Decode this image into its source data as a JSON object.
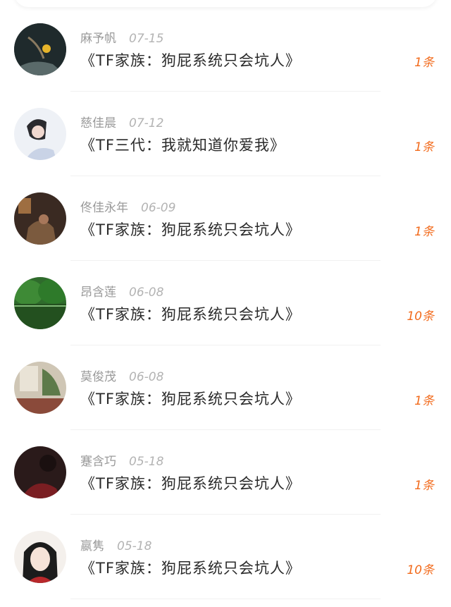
{
  "messages": [
    {
      "name": "麻予帆",
      "date": "07-15",
      "title": "《TF家族：狗屁系统只会坑人》",
      "count": "1条",
      "avatar": "avatar-1"
    },
    {
      "name": "慈佳晨",
      "date": "07-12",
      "title": "《TF三代：我就知道你爱我》",
      "count": "1条",
      "avatar": "avatar-2"
    },
    {
      "name": "佟佳永年",
      "date": "06-09",
      "title": "《TF家族：狗屁系统只会坑人》",
      "count": "1条",
      "avatar": "avatar-3"
    },
    {
      "name": "昂含莲",
      "date": "06-08",
      "title": "《TF家族：狗屁系统只会坑人》",
      "count": "10条",
      "avatar": "avatar-4"
    },
    {
      "name": "莫俊茂",
      "date": "06-08",
      "title": "《TF家族：狗屁系统只会坑人》",
      "count": "1条",
      "avatar": "avatar-5"
    },
    {
      "name": "蹇含巧",
      "date": "05-18",
      "title": "《TF家族：狗屁系统只会坑人》",
      "count": "1条",
      "avatar": "avatar-6"
    },
    {
      "name": "嬴隽",
      "date": "05-18",
      "title": "《TF家族：狗屁系统只会坑人》",
      "count": "10条",
      "avatar": "avatar-7"
    }
  ],
  "colors": {
    "count": "#f26a1b",
    "name": "#9a9a9a",
    "title": "#2a2a2a"
  }
}
